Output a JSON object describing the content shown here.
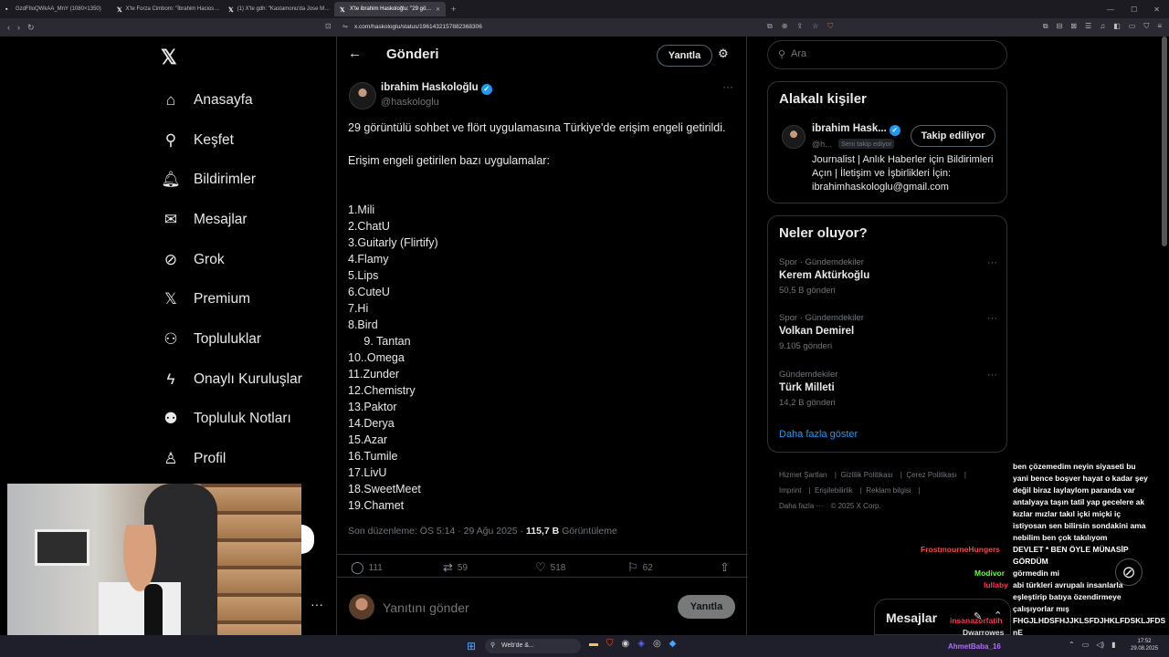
{
  "browser": {
    "tabs": [
      {
        "label": "GzdFIloQWkAA_MnY (1080×1350)",
        "icon": "image-icon",
        "active": false
      },
      {
        "label": "X'te Forza Cimbom: \"İbrahim Hacios…",
        "icon": "x-icon",
        "active": false
      },
      {
        "label": "(1) X'te gdh: \"Kastamonu'da Jose M…",
        "icon": "x-icon",
        "active": false
      },
      {
        "label": "X'te ibrahim Haskoloğlu: \"29 gö…",
        "icon": "x-icon",
        "active": true
      }
    ],
    "url": "x.com/haskologlu/status/1961432157882368306"
  },
  "sidebar": {
    "items": [
      {
        "label": "Anasayfa",
        "icon": "home-icon"
      },
      {
        "label": "Keşfet",
        "icon": "search-icon"
      },
      {
        "label": "Bildirimler",
        "icon": "bell-icon"
      },
      {
        "label": "Mesajlar",
        "icon": "mail-icon"
      },
      {
        "label": "Grok",
        "icon": "grok-icon"
      },
      {
        "label": "Premium",
        "icon": "x-icon"
      },
      {
        "label": "Topluluklar",
        "icon": "communities-icon"
      },
      {
        "label": "Onaylı Kuruluşlar",
        "icon": "lightning-icon"
      },
      {
        "label": "Topluluk Notları",
        "icon": "community-notes-icon"
      },
      {
        "label": "Profil",
        "icon": "person-icon"
      }
    ]
  },
  "main": {
    "header_title": "Gönderi",
    "reply_label": "Yanıtla",
    "post": {
      "author_name": "ibrahim Haskoloğlu",
      "author_handle": "@haskologlu",
      "text": "29 görüntülü sohbet ve flört uygulamasına Türkiye'de erişim engeli getirildi.\n\nErişim engeli getirilen bazı uygulamalar:",
      "list": [
        "1.Mili",
        "2.ChatU",
        "3.Guitarly (Flirtify)",
        "4.Flamy",
        "5.Lips",
        "6.CuteU",
        "7.Hi",
        "8.Bird",
        "     9. Tantan",
        "10..Omega",
        "11.Zunder",
        "12.Chemistry",
        "13.Paktor",
        "14.Derya",
        "15.Azar",
        "16.Tumile",
        "17.LivU",
        "18.SweetMeet",
        "19.Chamet"
      ],
      "edited": "Son düzenleme: ÖS 5:14 · 29 Ağu 2025 · ",
      "views": "115,7 B",
      "views_label": " Görüntüleme",
      "replies": "111",
      "reposts": "59",
      "likes": "518",
      "bookmarks": "62"
    },
    "compose_placeholder": "Yanıtını gönder",
    "compose_button": "Yanıtla"
  },
  "right": {
    "search_placeholder": "Ara",
    "related": {
      "title": "Alakalı kişiler",
      "name": "ibrahim Hask...",
      "handle": "@h...",
      "follows_you": "Seni takip ediyor",
      "follow_label": "Takip ediliyor",
      "bio": "Journalist | Anlık Haberler için Bildirimleri Açın | İletişim ve İşbirlikleri İçin: ibrahimhaskologlu@gmail.com"
    },
    "trends": {
      "title": "Neler oluyor?",
      "items": [
        {
          "category": "Spor · Gündemdekiler",
          "name": "Kerem Aktürkoğlu",
          "count": "50,5 B gönderi"
        },
        {
          "category": "Spor · Gündemdekiler",
          "name": "Volkan Demirel",
          "count": "9.105 gönderi"
        },
        {
          "category": "Gündemdekiler",
          "name": "Türk Milleti",
          "count": "14,2 B gönderi"
        }
      ],
      "show_more": "Daha fazla göster"
    },
    "footer": {
      "links": [
        "Hizmet Şartları",
        "Gizlilik Politikası",
        "Çerez Politikası",
        "Imprint",
        "Erişilebilirlik",
        "Reklam bilgisi",
        "Daha fazla ···"
      ],
      "copyright": "© 2025 X Corp."
    },
    "messages_label": "Mesajlar"
  },
  "stream_chat": {
    "lines": [
      "ben çözemedim neyin siyaseti bu",
      "yani bence boşver hayat o kadar şey",
      "değil biraz laylaylom paranda var",
      "antalyaya taşın tatil yap gecelere ak",
      "kızlar mızlar takıl içki miçki iç",
      "istiyosan sen bilirsin sondakini ama",
      "nebilim ben çok takılıyom",
      "DEVLET * BEN ÖYLE MÜNASİP",
      "GÖRDÜM",
      "görmedin mi",
      "abi türkleri avrupalı insanlarla",
      "eşleştirip batıya özendirmeye",
      "çalışıyorlar mış",
      "FHGJLHDSFHJJKLSFDJHKLFDSKLJFDS",
      "nE"
    ],
    "users": [
      {
        "name": "FrostmourneHungers",
        "color": "#ff4444"
      },
      {
        "name": "Modivor",
        "color": "#66ff33"
      },
      {
        "name": "lullaby",
        "color": "#ff3355"
      },
      {
        "name": "insanazorfatih",
        "color": "#ff3355"
      },
      {
        "name": "Dwarrowes",
        "color": "#dddddd"
      },
      {
        "name": "AhmetBaba_16",
        "color": "#b26bff"
      }
    ]
  },
  "taskbar": {
    "search_label": "Web'de &...",
    "time": "17:52",
    "date": "29.08.2025"
  }
}
